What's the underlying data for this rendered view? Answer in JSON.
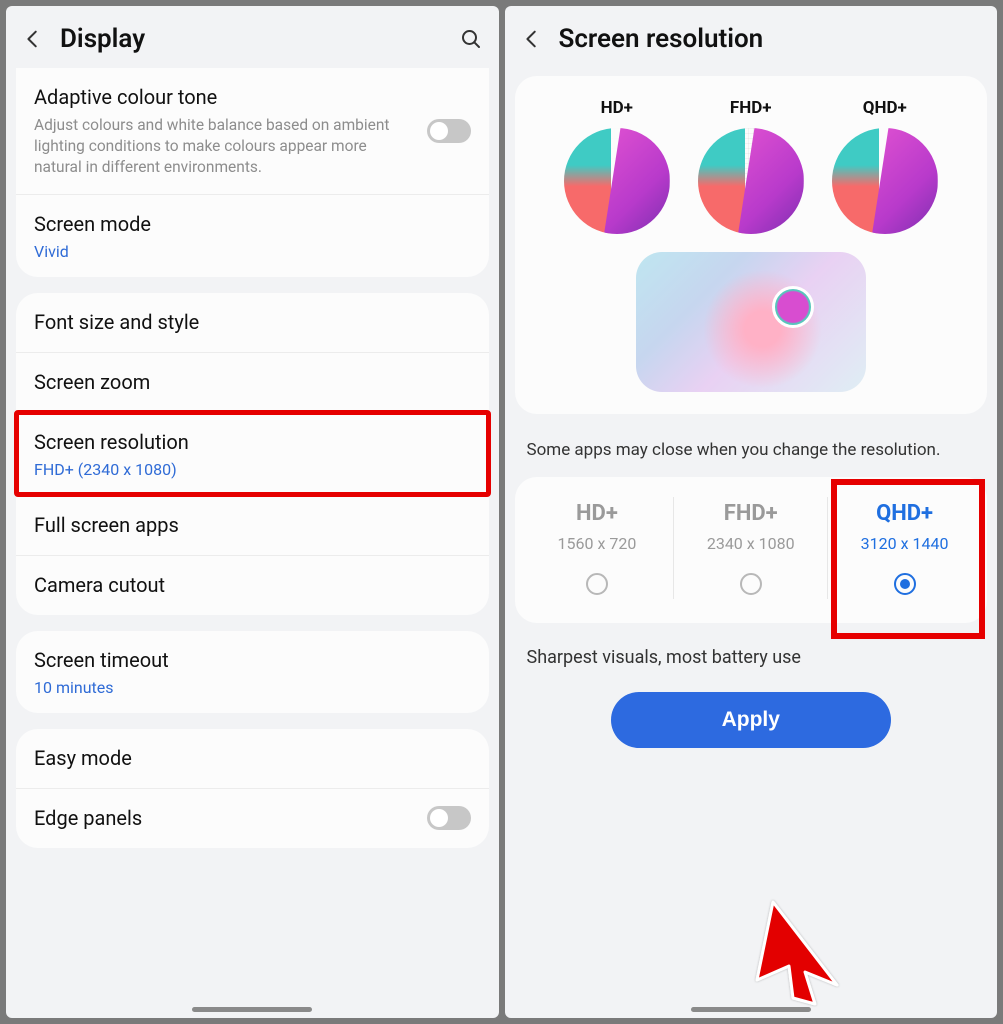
{
  "screen1": {
    "title": "Display",
    "adaptive": {
      "title": "Adaptive colour tone",
      "desc": "Adjust colours and white balance based on ambient lighting conditions to make colours appear more natural in different environments."
    },
    "screen_mode": {
      "title": "Screen mode",
      "value": "Vivid"
    },
    "font": "Font size and style",
    "zoom": "Screen zoom",
    "resolution": {
      "title": "Screen resolution",
      "value": "FHD+ (2340 x 1080)"
    },
    "fullscreen": "Full screen apps",
    "cutout": "Camera cutout",
    "timeout": {
      "title": "Screen timeout",
      "value": "10 minutes"
    },
    "easy": "Easy mode",
    "edge": "Edge panels"
  },
  "screen2": {
    "title": "Screen resolution",
    "previews": [
      "HD+",
      "FHD+",
      "QHD+"
    ],
    "warning": "Some apps may close when you change the resolution.",
    "options": [
      {
        "name": "HD+",
        "res": "1560 x 720",
        "selected": false
      },
      {
        "name": "FHD+",
        "res": "2340 x 1080",
        "selected": false
      },
      {
        "name": "QHD+",
        "res": "3120 x 1440",
        "selected": true
      }
    ],
    "selection_desc": "Sharpest visuals, most battery use",
    "apply": "Apply"
  }
}
